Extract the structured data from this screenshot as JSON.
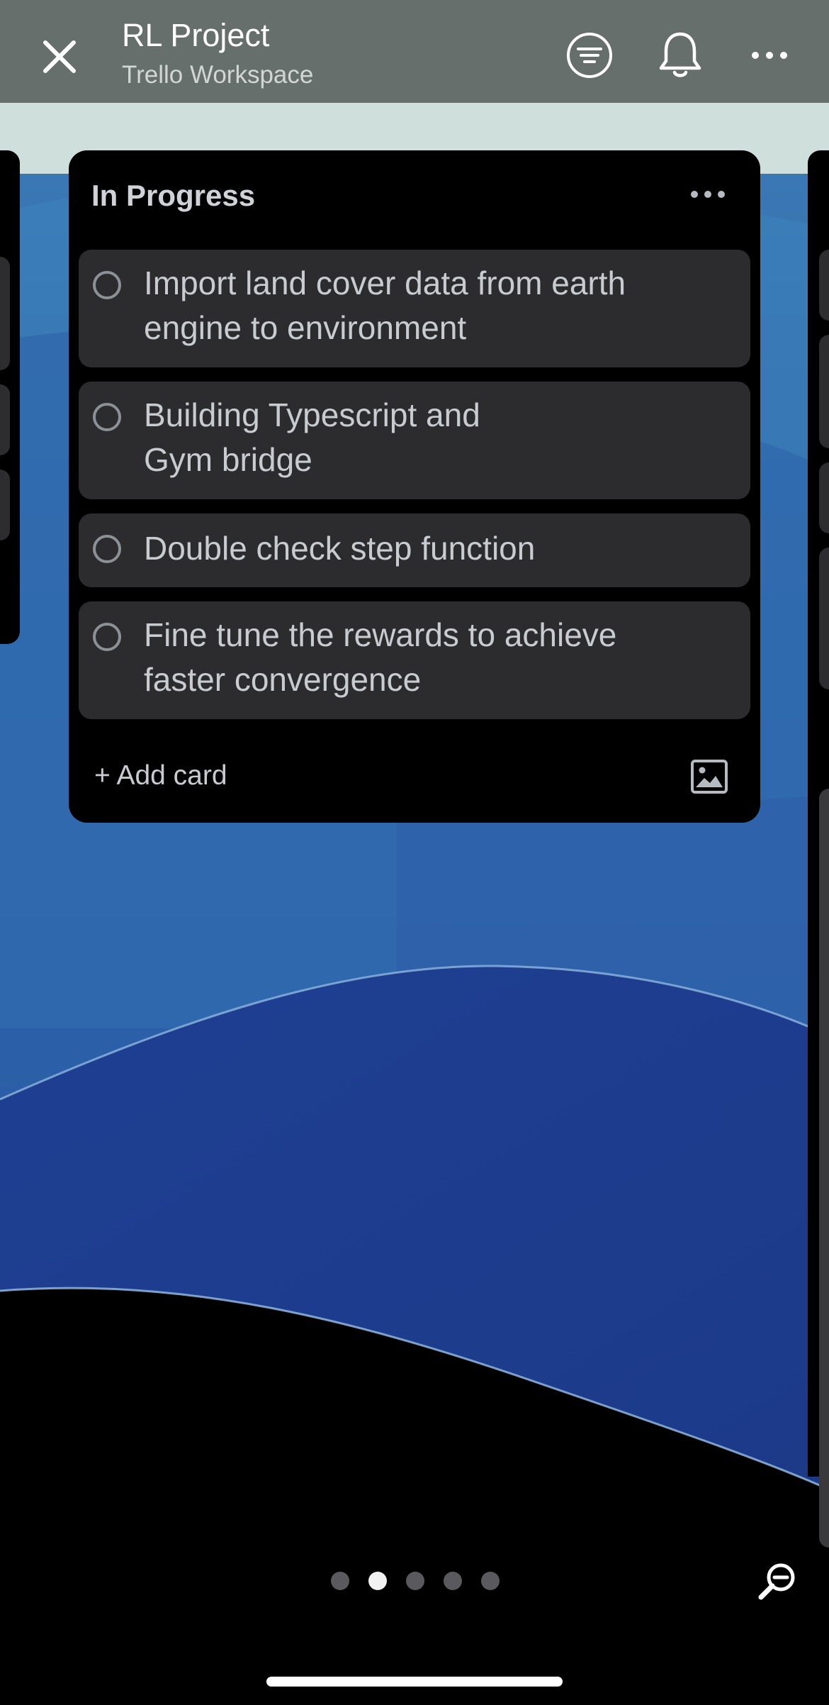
{
  "header": {
    "title": "RL Project",
    "subtitle": "Trello Workspace",
    "close_icon": "close-icon",
    "filter_icon": "filter-icon",
    "bell_icon": "bell-icon",
    "more_icon": "more-icon"
  },
  "list": {
    "title": "In Progress",
    "cards": [
      {
        "line1": "Import land cover data from earth",
        "line2": "engine to environment"
      },
      {
        "line1": "Building Typescript and",
        "line2": "Gym bridge"
      },
      {
        "line1": "Double check step function",
        "line2": ""
      },
      {
        "line1": "Fine tune the rewards to achieve",
        "line2": "faster convergence"
      }
    ],
    "add_card_label": "+ Add card",
    "image_icon": "image-icon"
  },
  "pagination": {
    "total": 5,
    "active_index": 1
  },
  "zoom_icon": "zoom-out-icon",
  "colors": {
    "header_bg": "#666f6b",
    "list_bg": "#000000",
    "card_bg": "#2c2c2e",
    "text": "#c8cbd0",
    "board_blue": "#1f3f8f"
  }
}
